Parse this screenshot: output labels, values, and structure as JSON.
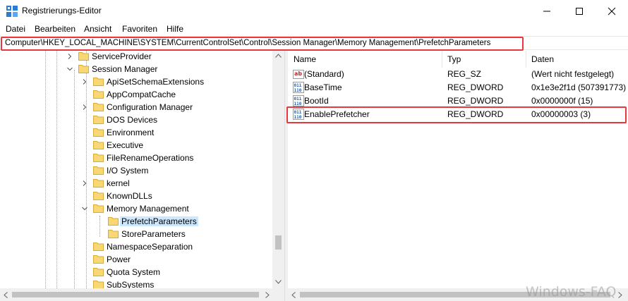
{
  "window": {
    "title": "Registrierungs-Editor"
  },
  "menu": [
    "Datei",
    "Bearbeiten",
    "Ansicht",
    "Favoriten",
    "Hilfe"
  ],
  "address": {
    "path": "Computer\\HKEY_LOCAL_MACHINE\\SYSTEM\\CurrentControlSet\\Control\\Session Manager\\Memory Management\\PrefetchParameters"
  },
  "tree": {
    "items": [
      {
        "label": "ServiceProvider",
        "chevron": "right"
      },
      {
        "label": "Session Manager",
        "chevron": "down"
      },
      {
        "label": "ApiSetSchemaExtensions",
        "chevron": "right"
      },
      {
        "label": "AppCompatCache",
        "chevron": ""
      },
      {
        "label": "Configuration Manager",
        "chevron": "right"
      },
      {
        "label": "DOS Devices",
        "chevron": ""
      },
      {
        "label": "Environment",
        "chevron": ""
      },
      {
        "label": "Executive",
        "chevron": ""
      },
      {
        "label": "FileRenameOperations",
        "chevron": ""
      },
      {
        "label": "I/O System",
        "chevron": ""
      },
      {
        "label": "kernel",
        "chevron": "right"
      },
      {
        "label": "KnownDLLs",
        "chevron": ""
      },
      {
        "label": "Memory Management",
        "chevron": "down"
      },
      {
        "label": "PrefetchParameters",
        "chevron": "",
        "selected": true
      },
      {
        "label": "StoreParameters",
        "chevron": ""
      },
      {
        "label": "NamespaceSeparation",
        "chevron": ""
      },
      {
        "label": "Power",
        "chevron": ""
      },
      {
        "label": "Quota System",
        "chevron": ""
      },
      {
        "label": "SubSystems",
        "chevron": ""
      }
    ]
  },
  "list": {
    "columns": {
      "name": "Name",
      "type": "Typ",
      "data": "Daten"
    },
    "rows": [
      {
        "name": "(Standard)",
        "type": "REG_SZ",
        "data": "(Wert nicht festgelegt)",
        "icon": "string-value-icon"
      },
      {
        "name": "BaseTime",
        "type": "REG_DWORD",
        "data": "0x1e3e2f1d (507391773)",
        "icon": "dword-value-icon"
      },
      {
        "name": "BootId",
        "type": "REG_DWORD",
        "data": "0x0000000f (15)",
        "icon": "dword-value-icon"
      },
      {
        "name": "EnablePrefetcher",
        "type": "REG_DWORD",
        "data": "0x00000003 (3)",
        "icon": "dword-value-icon"
      }
    ]
  },
  "watermark": "Windows-FAQ",
  "colors": {
    "highlight_red": "#e8383d",
    "selection": "#cce8ff",
    "folder": "#f8d775"
  }
}
